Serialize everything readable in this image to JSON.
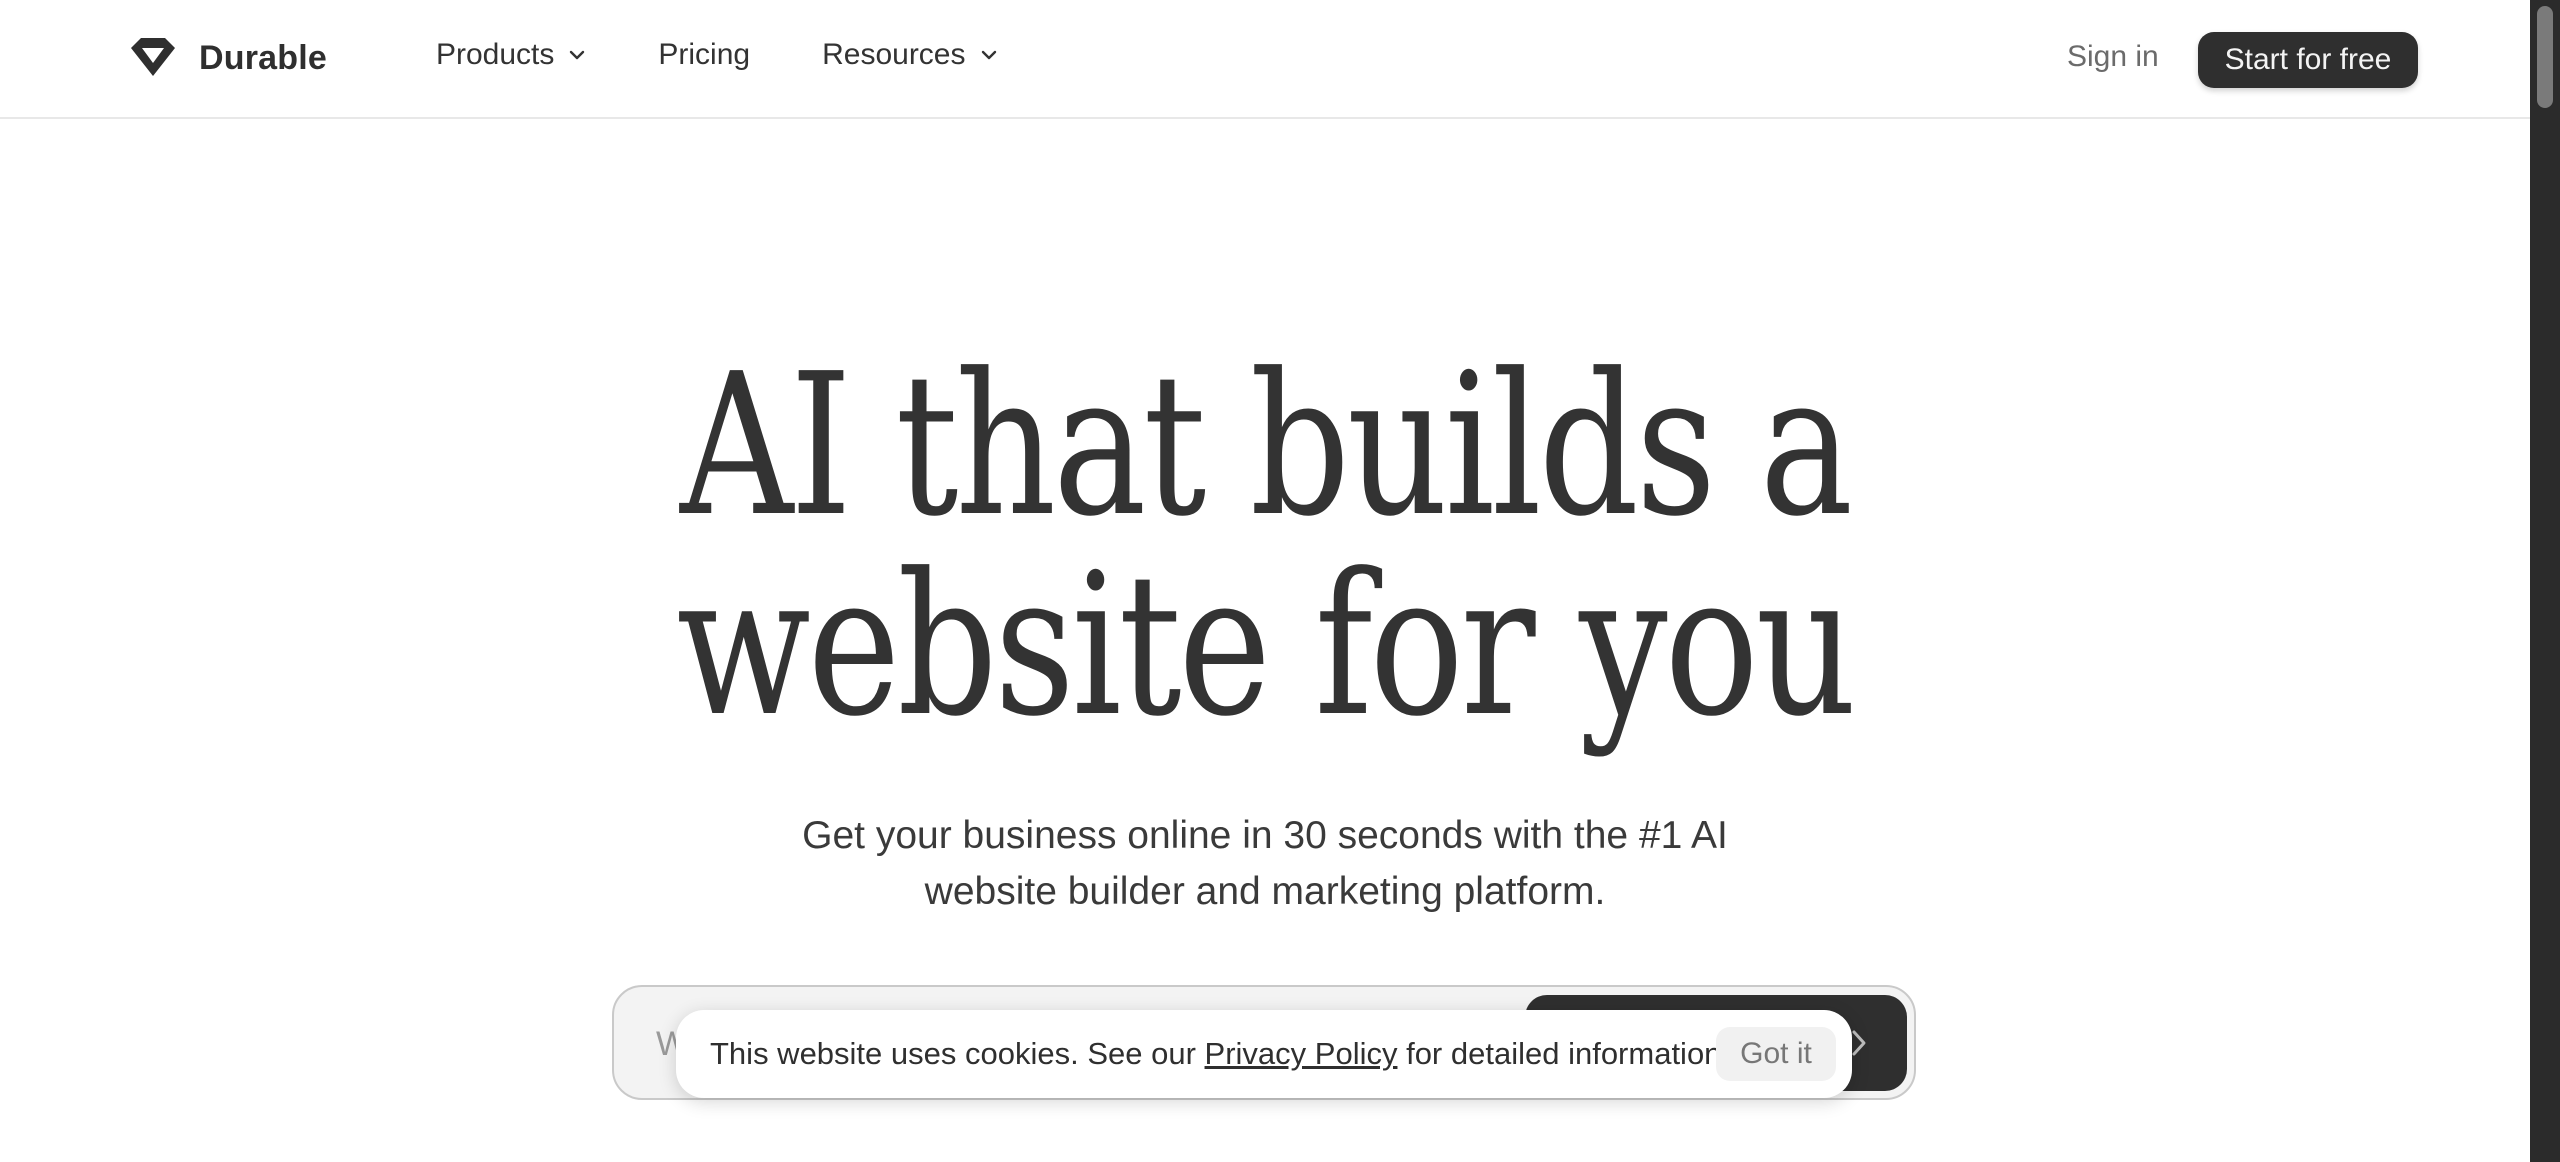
{
  "header": {
    "brand": "Durable",
    "nav": {
      "products": "Products",
      "pricing": "Pricing",
      "resources": "Resources"
    },
    "sign_in": "Sign in",
    "start_button": "Start for free"
  },
  "hero": {
    "title_line1": "AI that builds a",
    "title_line2": "website for you",
    "subtitle_line1": "Get your business online in 30 seconds with the #1 AI",
    "subtitle_line2": "website builder and marketing platform."
  },
  "prompt": {
    "placeholder": "W"
  },
  "cookie": {
    "text_before": "This website uses cookies. See our ",
    "link": "Privacy Policy",
    "text_after": " for detailed information.",
    "button": "Got it"
  },
  "icons": {
    "logo": "durable-logo-icon",
    "chevron": "chevron-down-icon",
    "arrow": "chevron-right-icon"
  },
  "colors": {
    "dark": "#2f2f2f",
    "text": "#333333",
    "muted": "#6b6b6b",
    "background": "#ffffff"
  }
}
